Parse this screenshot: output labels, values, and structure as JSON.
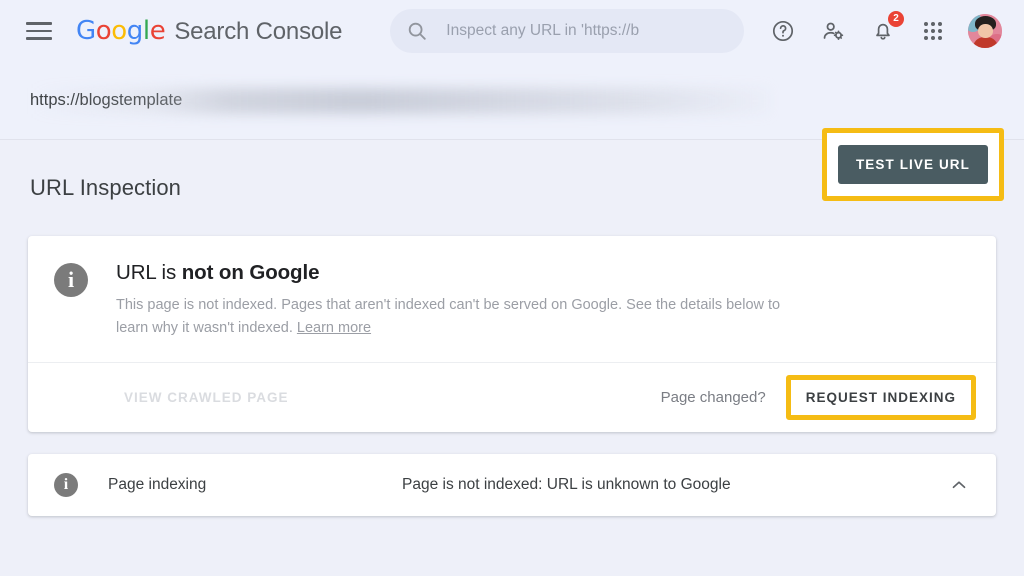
{
  "header": {
    "menu_icon": "hamburger-menu-icon",
    "logo_word": "Google",
    "logo_letters": [
      "G",
      "o",
      "o",
      "g",
      "l",
      "e"
    ],
    "product_name": "Search Console",
    "search": {
      "icon": "search-icon",
      "placeholder": "Inspect any URL in 'https://b",
      "value": ""
    },
    "actions": [
      {
        "name": "help-icon",
        "label": "Help"
      },
      {
        "name": "account-settings-icon",
        "label": "Account settings"
      },
      {
        "name": "notifications-bell-icon",
        "label": "Notifications",
        "badge": "2"
      },
      {
        "name": "apps-grid-icon",
        "label": "Google apps"
      },
      {
        "name": "avatar",
        "label": "Account"
      }
    ]
  },
  "property_bar": {
    "url_visible": "https://blogstemplate",
    "url_faded": "",
    "full_display": "https://blogstemplate"
  },
  "page": {
    "title": "URL Inspection",
    "test_live_url_label": "TEST LIVE URL"
  },
  "result_card": {
    "icon": "info-icon",
    "title_prefix": "URL is ",
    "title_bold": "not on Google",
    "description": "This page is not indexed. Pages that aren't indexed can't be served on Google. See the details below to learn why it wasn't indexed. ",
    "learn_more": "Learn more",
    "footer": {
      "view_crawled_page": "VIEW CRAWLED PAGE",
      "page_changed": "Page changed?",
      "request_indexing": "REQUEST INDEXING"
    }
  },
  "indexing_row": {
    "icon": "info-icon",
    "label": "Page indexing",
    "status": "Page is not indexed: URL is unknown to Google",
    "collapse_icon": "chevron-up-icon"
  },
  "colors": {
    "page_background": "#eef0f9",
    "header_background": "#eef1fb",
    "highlight_yellow": "#f5bc14",
    "dark_button": "#4a5c62",
    "badge_red": "#ea4335",
    "muted_text": "#9b9ea5",
    "disabled_text": "#dadce0"
  }
}
